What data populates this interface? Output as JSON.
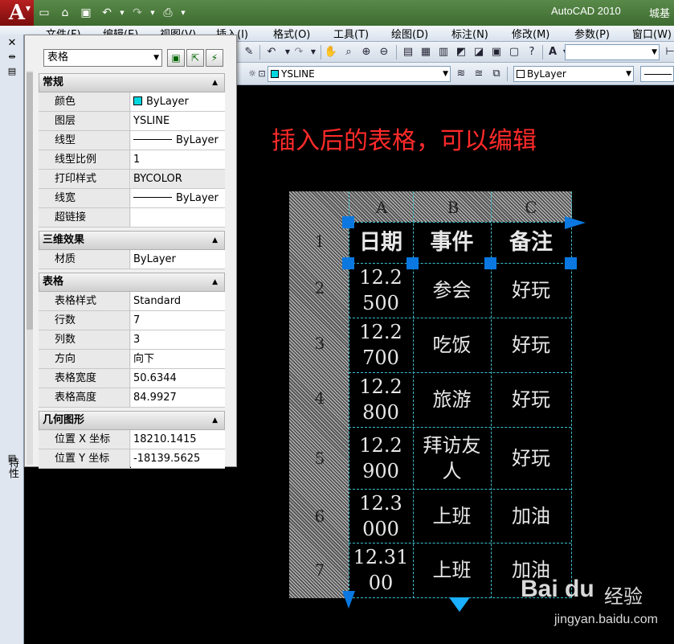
{
  "app": {
    "title": "AutoCAD 2010",
    "title_extra": "城基",
    "logo": "A"
  },
  "qat": {
    "icons": [
      "new-icon",
      "open-icon",
      "save-icon",
      "undo-icon",
      "redo-icon",
      "plot-icon"
    ]
  },
  "menubar": {
    "items": [
      "文件(F)",
      "编辑(E)",
      "视图(V)",
      "插入(I)",
      "格式(O)",
      "工具(T)",
      "绘图(D)",
      "标注(N)",
      "修改(M)",
      "参数(P)",
      "窗口(W)"
    ]
  },
  "toolbar2": {
    "layer_value": "YSLINE",
    "color_value": "ByLayer"
  },
  "dock": {
    "label": "特性"
  },
  "palette": {
    "object_type": "表格",
    "sections": [
      {
        "title": "常规",
        "rows": [
          {
            "key": "颜色",
            "value": "ByLayer"
          },
          {
            "key": "图层",
            "value": "YSLINE"
          },
          {
            "key": "线型",
            "value": "ByLayer"
          },
          {
            "key": "线型比例",
            "value": "1"
          },
          {
            "key": "打印样式",
            "value": "BYCOLOR"
          },
          {
            "key": "线宽",
            "value": "ByLayer"
          },
          {
            "key": "超链接",
            "value": ""
          }
        ]
      },
      {
        "title": "三维效果",
        "rows": [
          {
            "key": "材质",
            "value": "ByLayer"
          }
        ]
      },
      {
        "title": "表格",
        "rows": [
          {
            "key": "表格样式",
            "value": "Standard"
          },
          {
            "key": "行数",
            "value": "7"
          },
          {
            "key": "列数",
            "value": "3"
          },
          {
            "key": "方向",
            "value": "向下"
          },
          {
            "key": "表格宽度",
            "value": "50.6344"
          },
          {
            "key": "表格高度",
            "value": "84.9927"
          }
        ]
      },
      {
        "title": "几何图形",
        "rows": [
          {
            "key": "位置 X 坐标",
            "value": "18210.1415"
          },
          {
            "key": "位置 Y 坐标",
            "value": "-18139.5625"
          }
        ]
      }
    ]
  },
  "canvas": {
    "annotation": "插入后的表格，可以编辑",
    "table": {
      "columns": [
        "A",
        "B",
        "C"
      ],
      "row_numbers": [
        "1",
        "2",
        "3",
        "4",
        "5",
        "6",
        "7"
      ],
      "header": [
        "日期",
        "事件",
        "备注"
      ],
      "rows": [
        [
          "12.2\n500",
          "参会",
          "好玩"
        ],
        [
          "12.2\n700",
          "吃饭",
          "好玩"
        ],
        [
          "12.2\n800",
          "旅游",
          "好玩"
        ],
        [
          "12.2\n900",
          "拜访友\n人",
          "好玩"
        ],
        [
          "12.3\n000",
          "上班",
          "加油"
        ],
        [
          "12.31\n00",
          "上班",
          "加油"
        ]
      ]
    }
  },
  "watermark": {
    "brand": "Bai du",
    "cn": "经验",
    "url": "jingyan.baidu.com"
  },
  "colors": {
    "annotation": "#ff2a2a",
    "grip": "#0a78e0",
    "cell_line": "#3ac0d0",
    "color_swatch": "#00d8e0"
  }
}
